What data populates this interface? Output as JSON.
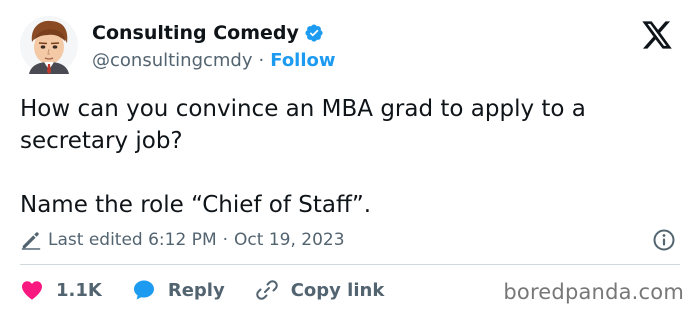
{
  "author": {
    "name": "Consulting Comedy",
    "handle": "@consultingcmdy",
    "separator": "·",
    "follow_label": "Follow"
  },
  "tweet": {
    "text": "How can you convince an MBA grad to apply to a\nsecretary job?\n\nName the role “Chief of Staff”."
  },
  "meta": {
    "edited_label": "Last edited 6:12 PM",
    "separator": "·",
    "date": "Oct 19, 2023"
  },
  "actions": {
    "like_count": "1.1K",
    "reply_label": "Reply",
    "copy_label": "Copy link"
  },
  "watermark": "boredpanda.com",
  "colors": {
    "accent": "#1d9bf0",
    "like": "#f91880",
    "muted": "#536471",
    "text": "#0f1419"
  },
  "icons": [
    "avatar",
    "verified-badge-icon",
    "x-logo-icon",
    "pencil-icon",
    "info-icon",
    "heart-icon",
    "reply-bubble-icon",
    "link-icon"
  ]
}
